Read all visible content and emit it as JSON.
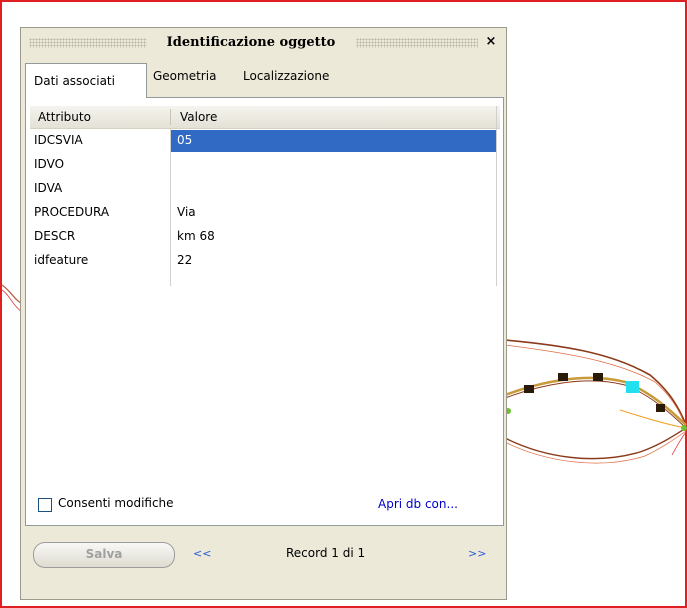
{
  "colors": {
    "map_border": "#e02020",
    "panel_bg": "#ece9d8",
    "selection": "#316ac5",
    "link": "#0000cc",
    "nav_link": "#2a5bd7",
    "route_line": "#8b3a1a",
    "route_highlight": "#c89a3a",
    "vertex_marker": "#2a1a0a",
    "selected_vertex": "#22e0ee"
  },
  "dialog": {
    "title": "Identificazione oggetto",
    "close_label": "×",
    "tabs": [
      {
        "label": "Dati associati",
        "active": true
      },
      {
        "label": "Geometria",
        "active": false
      },
      {
        "label": "Localizzazione",
        "active": false
      }
    ],
    "table": {
      "headers": [
        "Attributo",
        "Valore"
      ],
      "rows": [
        {
          "attribute": "IDCSVIA",
          "value": "05",
          "selected": true
        },
        {
          "attribute": "IDVO",
          "value": ""
        },
        {
          "attribute": "IDVA",
          "value": ""
        },
        {
          "attribute": "PROCEDURA",
          "value": "Via"
        },
        {
          "attribute": "DESCR",
          "value": "km 68"
        },
        {
          "attribute": "idfeature",
          "value": "22"
        }
      ]
    },
    "allow_edits_label": "Consenti modifiche",
    "allow_edits_checked": false,
    "open_db_label": "Apri db con...",
    "save_label": "Salva",
    "prev_label": "<<",
    "next_label": ">>",
    "record_label": "Record 1 di 1"
  },
  "map": {
    "icon": "map-features"
  }
}
